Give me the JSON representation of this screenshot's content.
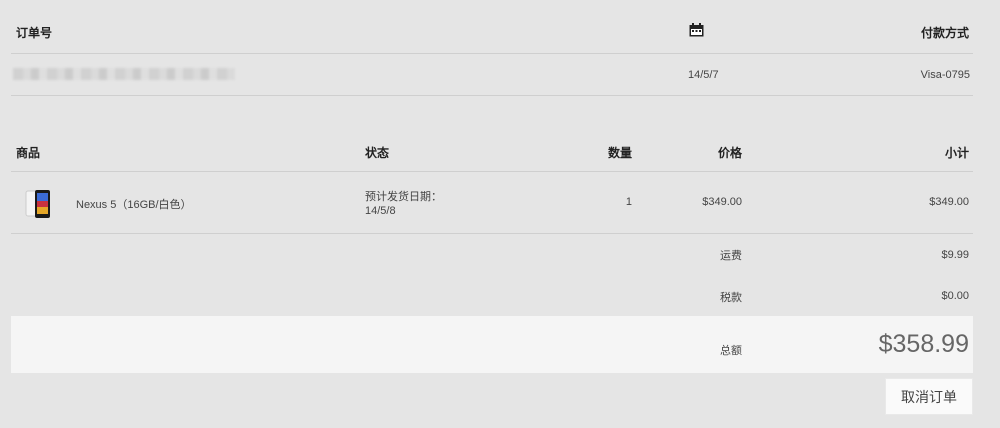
{
  "order_header": {
    "order_number_label": "订单号",
    "date_icon": "calendar-icon",
    "payment_label": "付款方式"
  },
  "order_info": {
    "order_number": "",
    "date": "14/5/7",
    "payment": "Visa-0795"
  },
  "items_header": {
    "product": "商品",
    "status": "状态",
    "quantity": "数量",
    "price": "价格",
    "subtotal": "小计"
  },
  "item": {
    "image": "phone-icon",
    "name": "Nexus 5（16GB/白色）",
    "status_line1": "预计发货日期：",
    "status_line2": "14/5/8",
    "quantity": "1",
    "price": "$349.00",
    "subtotal": "$349.00"
  },
  "summary": {
    "shipping_label": "运费",
    "shipping_value": "$9.99",
    "tax_label": "税款",
    "tax_value": "$0.00",
    "total_label": "总额",
    "total_value": "$358.99"
  },
  "actions": {
    "cancel_label": "取消订单"
  }
}
